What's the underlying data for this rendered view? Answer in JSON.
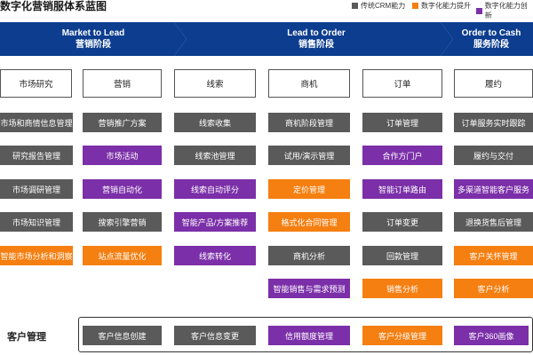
{
  "title": "数字化营销服体系蓝图",
  "legend": [
    {
      "label": "传统CRM能力",
      "color": "#5a5a5a"
    },
    {
      "label": "数字化能力提升",
      "color": "#f57f11"
    },
    {
      "label": "数字化能力创新",
      "color": "#7b2fa8"
    }
  ],
  "stages": [
    {
      "en": "Market to Lead",
      "cn": "营销阶段"
    },
    {
      "en": "Lead to Order",
      "cn": "销售阶段"
    },
    {
      "en": "Order to Cash",
      "cn": "服务阶段"
    }
  ],
  "columns": [
    {
      "header": "市场研究",
      "items": [
        {
          "label": "市场和商情信息管理",
          "type": "gray"
        },
        {
          "label": "研究报告管理",
          "type": "gray"
        },
        {
          "label": "市场调研管理",
          "type": "gray"
        },
        {
          "label": "市场知识管理",
          "type": "gray"
        },
        {
          "label": "智能市场分析和洞察",
          "type": "orange"
        }
      ]
    },
    {
      "header": "营销",
      "items": [
        {
          "label": "营销推广方案",
          "type": "gray"
        },
        {
          "label": "市场活动",
          "type": "purple"
        },
        {
          "label": "营销自动化",
          "type": "purple"
        },
        {
          "label": "搜索引擎营销",
          "type": "gray"
        },
        {
          "label": "站点流量优化",
          "type": "orange"
        }
      ]
    },
    {
      "header": "线索",
      "items": [
        {
          "label": "线索收集",
          "type": "gray"
        },
        {
          "label": "线索池管理",
          "type": "gray"
        },
        {
          "label": "线索自动评分",
          "type": "purple"
        },
        {
          "label": "智能产品/方案推荐",
          "type": "purple"
        },
        {
          "label": "线索转化",
          "type": "purple"
        }
      ]
    },
    {
      "header": "商机",
      "items": [
        {
          "label": "商机阶段管理",
          "type": "gray"
        },
        {
          "label": "试用/演示管理",
          "type": "gray"
        },
        {
          "label": "定价管理",
          "type": "orange"
        },
        {
          "label": "格式化合同管理",
          "type": "orange"
        },
        {
          "label": "商机分析",
          "type": "gray"
        },
        {
          "label": "智能销售与需求预测",
          "type": "purple"
        }
      ]
    },
    {
      "header": "订单",
      "items": [
        {
          "label": "订单管理",
          "type": "gray"
        },
        {
          "label": "合作方门户",
          "type": "purple"
        },
        {
          "label": "智能订单路由",
          "type": "purple"
        },
        {
          "label": "订单变更",
          "type": "gray"
        },
        {
          "label": "回款管理",
          "type": "gray"
        },
        {
          "label": "销售分析",
          "type": "orange"
        }
      ]
    },
    {
      "header": "履约",
      "items": [
        {
          "label": "订单服务实时跟踪",
          "type": "gray"
        },
        {
          "label": "履约与交付",
          "type": "gray"
        },
        {
          "label": "多渠道智能客户服务",
          "type": "purple"
        },
        {
          "label": "退换货售后管理",
          "type": "gray"
        },
        {
          "label": "客户关怀管理",
          "type": "orange"
        },
        {
          "label": "客户分析",
          "type": "orange"
        }
      ]
    }
  ],
  "customer_mgmt": {
    "label": "客户管理",
    "items": [
      {
        "label": "客户信息创建",
        "type": "gray"
      },
      {
        "label": "客户信息变更",
        "type": "gray"
      },
      {
        "label": "信用额度管理",
        "type": "purple"
      },
      {
        "label": "客户分级管理",
        "type": "orange"
      },
      {
        "label": "客户360画像",
        "type": "purple"
      }
    ]
  }
}
